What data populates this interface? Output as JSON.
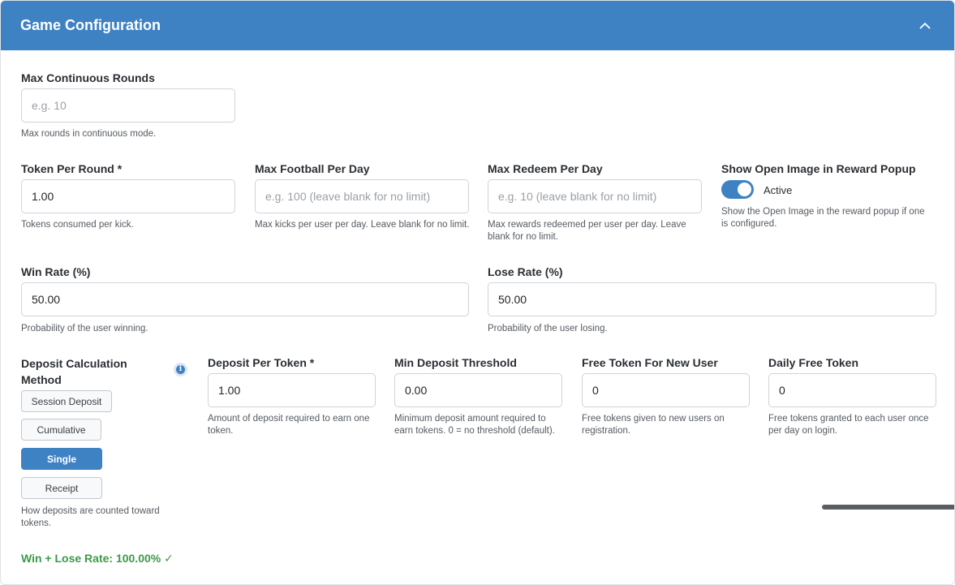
{
  "header": {
    "title": "Game Configuration"
  },
  "max_continuous_rounds": {
    "label": "Max Continuous Rounds",
    "value": "",
    "placeholder": "e.g. 10",
    "help": "Max rounds in continuous mode."
  },
  "token_per_round": {
    "label": "Token Per Round *",
    "value": "1.00",
    "placeholder": "",
    "help": "Tokens consumed per kick."
  },
  "max_football_per_day": {
    "label": "Max Football Per Day",
    "value": "",
    "placeholder": "e.g. 100 (leave blank for no limit)",
    "help": "Max kicks per user per day. Leave blank for no limit."
  },
  "max_redeem_per_day": {
    "label": "Max Redeem Per Day",
    "value": "",
    "placeholder": "e.g. 10 (leave blank for no limit)",
    "help": "Max rewards redeemed per user per day. Leave blank for no limit."
  },
  "show_open_image": {
    "label": "Show Open Image in Reward Popup",
    "state": "Active",
    "enabled": true,
    "help": "Show the Open Image in the reward popup if one is configured."
  },
  "win_rate": {
    "label": "Win Rate (%)",
    "value": "50.00",
    "help": "Probability of the user winning."
  },
  "lose_rate": {
    "label": "Lose Rate (%)",
    "value": "50.00",
    "help": "Probability of the user losing."
  },
  "deposit_method": {
    "label": "Deposit Calculation Method",
    "info_icon": "info-circle-icon",
    "options": [
      "Session Deposit",
      "Cumulative",
      "Single",
      "Receipt"
    ],
    "selected": "Single",
    "help": "How deposits are counted toward tokens."
  },
  "deposit_per_token": {
    "label": "Deposit Per Token *",
    "value": "1.00",
    "help": "Amount of deposit required to earn one token."
  },
  "min_deposit_threshold": {
    "label": "Min Deposit Threshold",
    "value": "0.00",
    "help": "Minimum deposit amount required to earn tokens. 0 = no threshold (default)."
  },
  "free_token_new_user": {
    "label": "Free Token For New User",
    "value": "0",
    "help": "Free tokens given to new users on registration."
  },
  "daily_free_token": {
    "label": "Daily Free Token",
    "value": "0",
    "help": "Free tokens granted to each user once per day on login."
  },
  "summary": {
    "text": "Win + Lose Rate: 100.00% ✓"
  },
  "colors": {
    "header": "#3f82c4",
    "accent": "#3f82c4",
    "success": "#3c9a47"
  }
}
